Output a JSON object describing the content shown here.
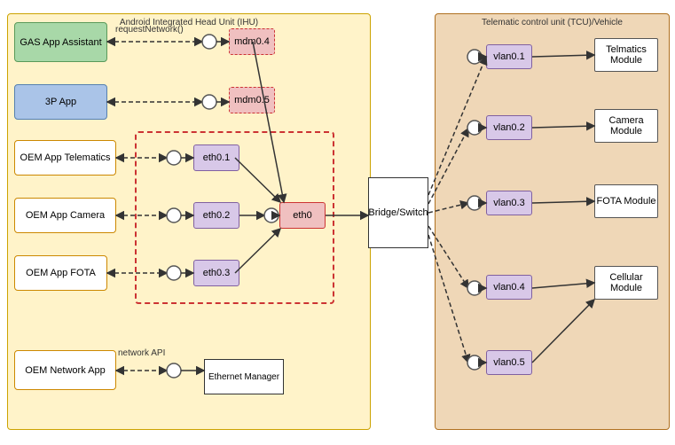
{
  "ihu": {
    "label": "Android Integrated Head Unit (IHU)"
  },
  "tcu": {
    "label": "Telematic control unit (TCU)/Vehicle"
  },
  "apps": {
    "gas": "GAS App Assistant",
    "threep": "3P App",
    "oem_telematics": "OEM App Telematics",
    "oem_camera": "OEM App Camera",
    "oem_fota": "OEM App FOTA",
    "oem_network": "OEM Network App"
  },
  "interfaces": {
    "mdm04": "mdm0.4",
    "mdm05": "mdm0.5",
    "eth01": "eth0.1",
    "eth02": "eth0.2",
    "eth03": "eth0.3",
    "eth0": "eth0"
  },
  "bridge": "Bridge/Switch",
  "eth_manager": "Ethernet Manager",
  "vlans": {
    "vlan01": "vlan0.1",
    "vlan02": "vlan0.2",
    "vlan03": "vlan0.3",
    "vlan04": "vlan0.4",
    "vlan05": "vlan0.5"
  },
  "modules": {
    "telmatics": "Telmatics Module",
    "camera": "Camera Module",
    "fota": "FOTA Module",
    "cellular": "Cellular Module"
  },
  "labels": {
    "request_network": "requestNetwork()",
    "network_api": "network API"
  }
}
